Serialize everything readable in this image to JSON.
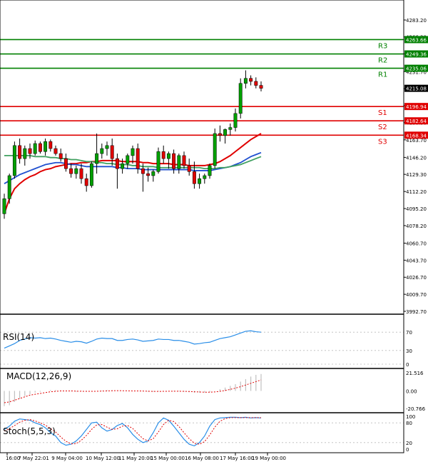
{
  "chart_data": {
    "type": "candlestick",
    "instrument": "",
    "price_axis": {
      "ticks": [
        "4283.20",
        "4266.30",
        "4249.40",
        "4231.70",
        "4214.70",
        "4197.80",
        "4180.90",
        "4163.70",
        "4146.20",
        "4129.30",
        "4112.20",
        "4095.20",
        "4078.20",
        "4060.70",
        "4043.70",
        "4026.70",
        "4009.70",
        "3992.70"
      ],
      "range": [
        3992.7,
        4283.2
      ]
    },
    "time_axis": {
      "labels": [
        "16:00",
        "7 May 22:01",
        "9 May 04:00",
        "10 May 12:00",
        "11 May 20:00",
        "15 May 00:00",
        "16 May 08:00",
        "17 May 16:00",
        "19 May 00:00"
      ]
    },
    "current_price": "4215.08",
    "levels": [
      {
        "name": "R3",
        "value": 4263.66,
        "label": "4263.66",
        "color": "#008000"
      },
      {
        "name": "R2",
        "value": 4249.36,
        "label": "4249.36",
        "color": "#008000"
      },
      {
        "name": "R1",
        "value": 4235.06,
        "label": "4235.06",
        "color": "#008000"
      },
      {
        "name": "S1",
        "value": 4196.94,
        "label": "4196.94",
        "color": "#e00000"
      },
      {
        "name": "S2",
        "value": 4182.64,
        "label": "4182.64",
        "color": "#e00000"
      },
      {
        "name": "S3",
        "value": 4168.34,
        "label": "4168.34",
        "color": "#e00000"
      }
    ],
    "candles": [
      [
        4090,
        4110,
        4085,
        4105
      ],
      [
        4105,
        4130,
        4100,
        4128
      ],
      [
        4128,
        4162,
        4125,
        4158
      ],
      [
        4158,
        4165,
        4140,
        4145
      ],
      [
        4145,
        4158,
        4138,
        4155
      ],
      [
        4155,
        4160,
        4145,
        4150
      ],
      [
        4150,
        4163,
        4148,
        4160
      ],
      [
        4160,
        4162,
        4150,
        4152
      ],
      [
        4152,
        4165,
        4148,
        4162
      ],
      [
        4162,
        4164,
        4152,
        4155
      ],
      [
        4155,
        4158,
        4148,
        4150
      ],
      [
        4150,
        4155,
        4142,
        4145
      ],
      [
        4145,
        4150,
        4132,
        4135
      ],
      [
        4135,
        4140,
        4126,
        4130
      ],
      [
        4130,
        4138,
        4125,
        4135
      ],
      [
        4135,
        4140,
        4120,
        4125
      ],
      [
        4125,
        4130,
        4112,
        4118
      ],
      [
        4118,
        4142,
        4116,
        4140
      ],
      [
        4140,
        4170,
        4130,
        4150
      ],
      [
        4150,
        4160,
        4145,
        4155
      ],
      [
        4155,
        4162,
        4148,
        4158
      ],
      [
        4158,
        4165,
        4138,
        4145
      ],
      [
        4145,
        4150,
        4115,
        4135
      ],
      [
        4135,
        4145,
        4130,
        4140
      ],
      [
        4140,
        4150,
        4135,
        4148
      ],
      [
        4148,
        4158,
        4140,
        4155
      ],
      [
        4155,
        4160,
        4130,
        4135
      ],
      [
        4135,
        4140,
        4112,
        4130
      ],
      [
        4130,
        4136,
        4122,
        4128
      ],
      [
        4128,
        4134,
        4122,
        4132
      ],
      [
        4132,
        4156,
        4130,
        4152
      ],
      [
        4152,
        4158,
        4140,
        4145
      ],
      [
        4145,
        4152,
        4135,
        4150
      ],
      [
        4150,
        4154,
        4130,
        4135
      ],
      [
        4135,
        4150,
        4130,
        4148
      ],
      [
        4148,
        4152,
        4135,
        4138
      ],
      [
        4138,
        4145,
        4128,
        4132
      ],
      [
        4132,
        4142,
        4115,
        4120
      ],
      [
        4120,
        4130,
        4115,
        4125
      ],
      [
        4125,
        4130,
        4120,
        4128
      ],
      [
        4128,
        4140,
        4125,
        4138
      ],
      [
        4138,
        4175,
        4135,
        4170
      ],
      [
        4170,
        4178,
        4162,
        4168
      ],
      [
        4168,
        4175,
        4160,
        4174
      ],
      [
        4174,
        4180,
        4168,
        4176
      ],
      [
        4176,
        4195,
        4172,
        4190
      ],
      [
        4190,
        4225,
        4185,
        4220
      ],
      [
        4220,
        4233,
        4215,
        4225
      ],
      [
        4225,
        4228,
        4218,
        4222
      ],
      [
        4222,
        4226,
        4215,
        4218
      ],
      [
        4218,
        4222,
        4212,
        4215.08
      ]
    ],
    "moving_averages": [
      {
        "color": "#e00000",
        "values": [
          4090,
          4105,
          4115,
          4120,
          4124,
          4127,
          4129,
          4132,
          4134,
          4135,
          4137,
          4138,
          4139,
          4140,
          4140,
          4141,
          4141,
          4142,
          4142,
          4143,
          4143,
          4143,
          4143,
          4142,
          4142,
          4142,
          4142,
          4141,
          4141,
          4140,
          4140,
          4140,
          4140,
          4139,
          4139,
          4139,
          4138,
          4138,
          4138,
          4138,
          4139,
          4140,
          4142,
          4145,
          4148,
          4152,
          4156,
          4160,
          4164,
          4167,
          4170
        ]
      },
      {
        "color": "#2050d0",
        "values": [
          4120,
          4123,
          4126,
          4129,
          4131,
          4133,
          4135,
          4137,
          4139,
          4140,
          4141,
          4141,
          4140,
          4139,
          4139,
          4138,
          4137,
          4137,
          4137,
          4137,
          4137,
          4137,
          4136,
          4136,
          4135,
          4135,
          4135,
          4134,
          4134,
          4134,
          4134,
          4134,
          4134,
          4134,
          4134,
          4134,
          4134,
          4133,
          4133,
          4133,
          4133,
          4134,
          4135,
          4136,
          4137,
          4139,
          4141,
          4144,
          4147,
          4149,
          4151
        ]
      },
      {
        "color": "#40a060",
        "values": [
          4148,
          4148,
          4148,
          4148,
          4148,
          4148,
          4147,
          4147,
          4147,
          4146,
          4146,
          4145,
          4145,
          4144,
          4144,
          4143,
          4142,
          4142,
          4141,
          4141,
          4140,
          4140,
          4139,
          4139,
          4139,
          4138,
          4138,
          4137,
          4137,
          4137,
          4136,
          4136,
          4136,
          4136,
          4136,
          4136,
          4136,
          4136,
          4136,
          4135,
          4135,
          4135,
          4136,
          4136,
          4137,
          4138,
          4139,
          4141,
          4143,
          4145,
          4147
        ]
      }
    ],
    "rsi": {
      "label": "RSI(14)",
      "ticks": [
        "70",
        "30",
        "0"
      ],
      "tick_values": [
        70,
        30,
        0
      ],
      "values": [
        35,
        40,
        45,
        52,
        55,
        58,
        57,
        58,
        56,
        57,
        55,
        52,
        50,
        48,
        50,
        49,
        46,
        50,
        55,
        57,
        56,
        56,
        52,
        52,
        54,
        55,
        53,
        50,
        51,
        52,
        55,
        54,
        54,
        52,
        52,
        50,
        48,
        44,
        45,
        47,
        48,
        52,
        56,
        58,
        60,
        64,
        68,
        72,
        73,
        71,
        70
      ]
    },
    "macd": {
      "label": "MACD(12,26,9)",
      "ticks": [
        "21.516",
        "0.00",
        "-20.766"
      ],
      "range": [
        -20.766,
        21.516
      ],
      "histogram": [
        -18,
        -17,
        -13,
        -9,
        -6,
        -4,
        -2,
        -1,
        0,
        1,
        1,
        0.5,
        0,
        -0.5,
        -1,
        -0.5,
        -1,
        -0.5,
        0,
        0.5,
        1,
        1,
        0.5,
        0,
        0,
        0,
        0,
        -0.5,
        -1,
        -1,
        -0.5,
        0,
        0,
        -0.5,
        -0.5,
        -1,
        -1.5,
        -2,
        -2,
        -2,
        -1.5,
        0,
        2,
        4,
        6,
        8,
        11,
        14,
        17,
        19,
        20
      ],
      "signal": [
        -14,
        -13,
        -11,
        -9,
        -7,
        -5,
        -4,
        -3,
        -2,
        -1,
        -0.5,
        0,
        0,
        0,
        -0.3,
        -0.4,
        -0.5,
        -0.5,
        -0.4,
        -0.2,
        0,
        0.2,
        0.3,
        0.2,
        0.1,
        0,
        0,
        -0.2,
        -0.4,
        -0.6,
        -0.6,
        -0.5,
        -0.4,
        -0.4,
        -0.4,
        -0.5,
        -0.7,
        -1,
        -1.3,
        -1.5,
        -1.5,
        -1.2,
        -0.5,
        0.5,
        1.8,
        3.3,
        5,
        7,
        9,
        11,
        13
      ]
    },
    "stoch": {
      "label": "Stoch(5,5,3)",
      "ticks": [
        "100",
        "80",
        "20",
        "0"
      ],
      "tick_values": [
        100,
        80,
        20,
        0
      ],
      "k": [
        60,
        70,
        85,
        92,
        90,
        88,
        80,
        75,
        65,
        50,
        40,
        20,
        12,
        15,
        25,
        40,
        60,
        80,
        82,
        65,
        55,
        60,
        72,
        78,
        65,
        45,
        30,
        20,
        25,
        50,
        80,
        95,
        88,
        70,
        50,
        30,
        15,
        10,
        20,
        40,
        70,
        90,
        95,
        96,
        97,
        97,
        96,
        97,
        95,
        96,
        95
      ],
      "d": [
        55,
        62,
        72,
        82,
        88,
        90,
        86,
        80,
        73,
        63,
        52,
        37,
        24,
        16,
        17,
        27,
        42,
        60,
        74,
        75,
        67,
        60,
        62,
        70,
        72,
        63,
        47,
        32,
        25,
        32,
        52,
        75,
        88,
        84,
        69,
        50,
        32,
        18,
        15,
        23,
        43,
        67,
        85,
        93,
        96,
        96,
        96,
        96,
        96,
        96,
        96
      ]
    }
  }
}
